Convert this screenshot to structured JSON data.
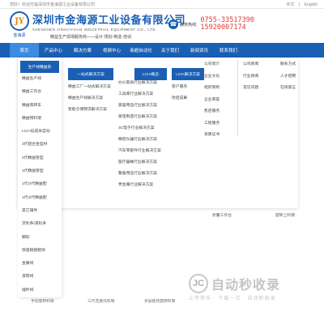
{
  "topbar": {
    "welcome": "您好！欢迎光临深圳市金海源工业设备有限公司",
    "lang_cn": "中文",
    "sep": "|",
    "lang_en": "English"
  },
  "header": {
    "logo_mark": "JY",
    "logo_text": "金海源",
    "company_cn": "深圳市金海源工业设备有限公司",
    "company_en": "SHENZHEN JINHAIYUAN INDUSTRIAL EQUIPMENT CO., LTD.",
    "slogan": "精益生产现场服务商——设计·规划·制造·培训",
    "hotline_label": "服务热线:",
    "phone1": "0755-33517390",
    "phone2": "15920007174",
    "phone_icon": "phone-icon"
  },
  "nav": [
    "首页",
    "产品中心",
    "解决方案",
    "视频中心",
    "商超自动化",
    "关于我们",
    "新闻资讯",
    "联系我们"
  ],
  "categories": {
    "header": "生产线精益系",
    "items": [
      "精益生产线",
      "精益工作台",
      "精益周转车",
      "精益物料架",
      "LCIA低成本自动",
      "3代铝合金型材",
      "2代精益管型",
      "1代精益管型",
      "1代/2代精益配",
      "1代/2代精益配",
      "其它辅件",
      "流利条/滚轮条",
      "脚轮",
      "快速链接配线",
      "金属线",
      "滚筒线",
      "插件线"
    ]
  },
  "solutions": {
    "header": "一站式解决方案",
    "items": [
      "精益工厂一站式解决方案",
      "精益生产线解决方案",
      "智能仓储物流解决方案"
    ]
  },
  "industry": {
    "items": [
      "办公家具行业解决方案",
      "工具库行业解决方案",
      "家居用品行业解决方案",
      "家电制造行业解决方案",
      "3C电子行业解决方案",
      "精密仪器行业解决方案",
      "汽车零部件行业解决方案",
      "医疗器械行业解决方案",
      "警备用品行业解决方案",
      "贵金属行业解决方案"
    ]
  },
  "lcia": {
    "header": "LCIA概念",
    "items": [
      "客户服务",
      "改造成果"
    ]
  },
  "lcia_solution": {
    "header": "LCIA解决方案"
  },
  "about": {
    "col1": [
      "公司简介",
      "企业文化",
      "组织架构",
      "企业荣誉",
      "售后服务",
      "工程服务",
      "资质证书"
    ],
    "col2": [
      "公司新闻",
      "行业新闻",
      "常见问题"
    ],
    "col3": [
      "联系方式",
      "人才招聘",
      "在线留言"
    ]
  },
  "below": {
    "label1": "折叠工作台",
    "label2": "旋转上料架"
  },
  "bottom": {
    "label1": "手动旋转料架",
    "label2": "三代无底托料架",
    "label3": "多层拣货旋转料架"
  },
  "watermark": {
    "logo": "JC",
    "text": "自动秒收录",
    "sub": "上传快乐 · 下载一次 · 自动秒收录"
  }
}
